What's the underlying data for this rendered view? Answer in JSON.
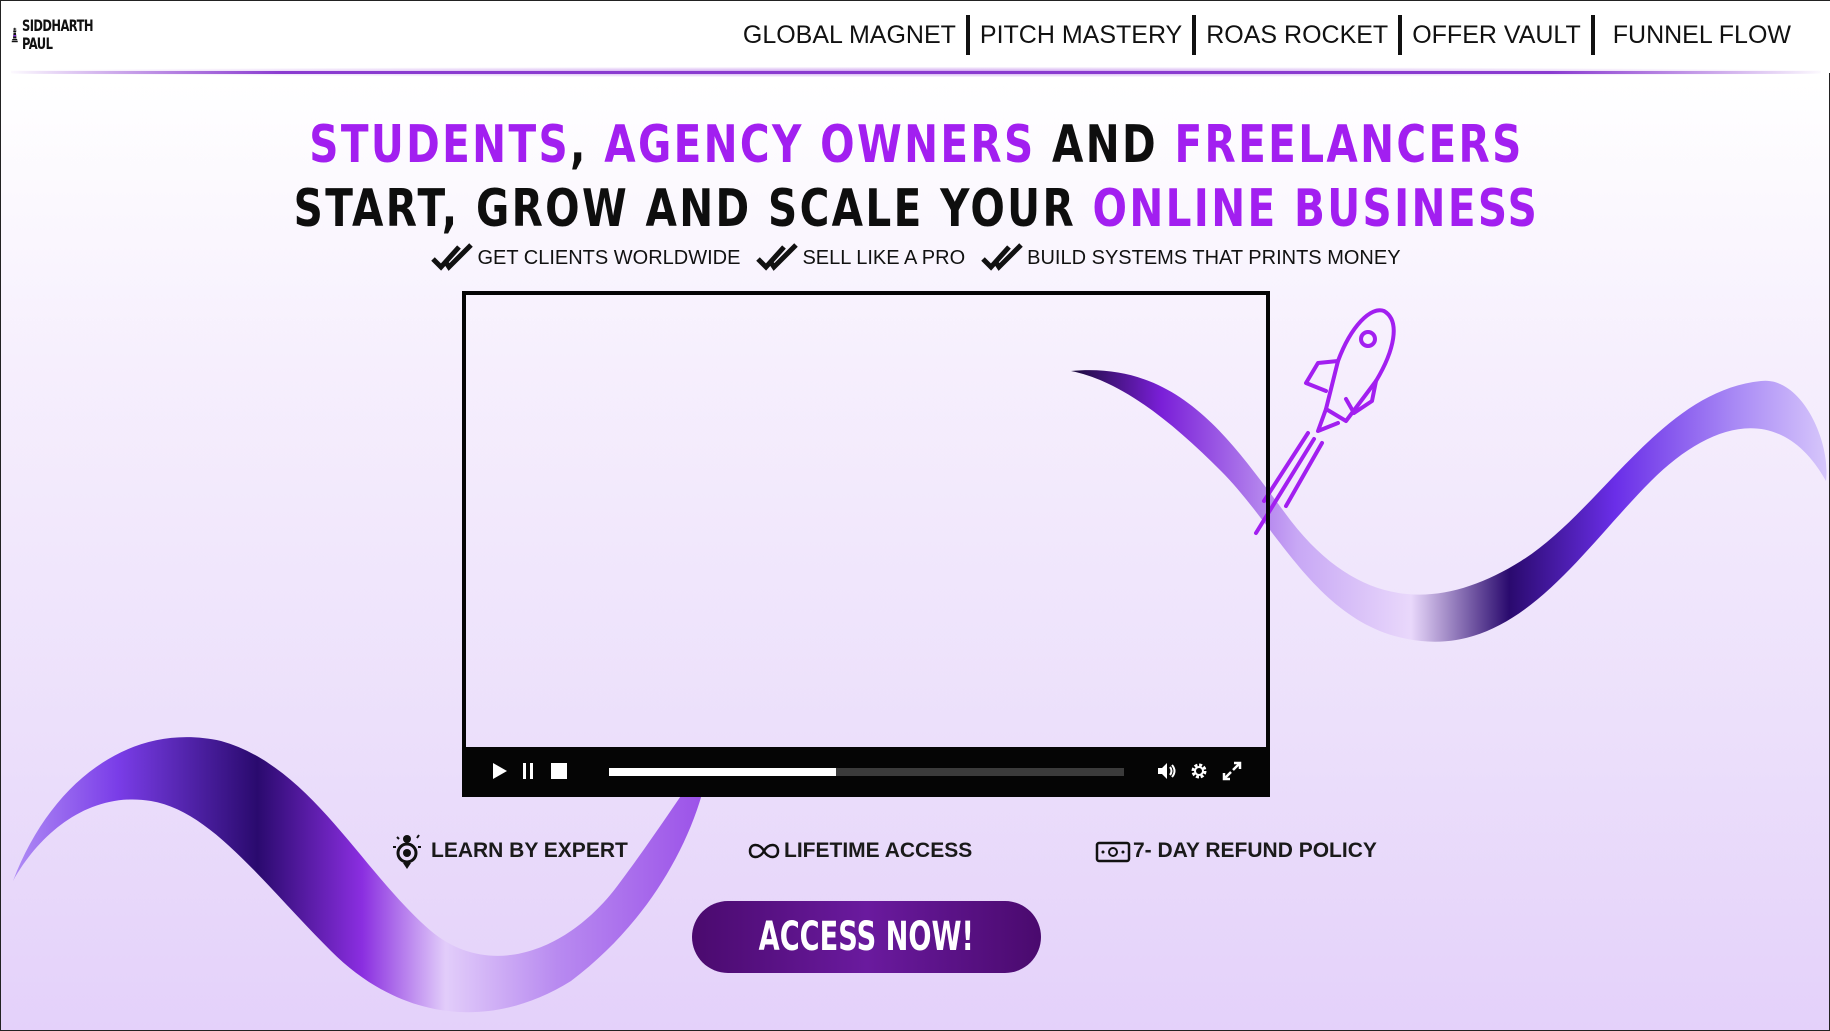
{
  "brand": {
    "logo_line1": "SIDDHARTH",
    "logo_line2": "PAUL",
    "logo_icon": "chess-king-icon"
  },
  "nav": {
    "items": [
      "GLOBAL MAGNET",
      "PITCH MASTERY",
      "ROAS ROCKET",
      "OFFER VAULT",
      "FUNNEL FLOW"
    ]
  },
  "headline": {
    "line1": {
      "part1": "STUDENTS",
      "sep1": ", ",
      "part2": "AGENCY OWNERS",
      "sep2": " AND ",
      "part3": "FREELANCERS"
    },
    "line2": {
      "part1": "START, GROW AND SCALE YOUR ",
      "part2": "ONLINE BUSINESS"
    }
  },
  "features": [
    {
      "label": "GET CLIENTS WORLDWIDE",
      "icon": "double-check-icon"
    },
    {
      "label": "SELL LIKE A PRO",
      "icon": "double-check-icon"
    },
    {
      "label": "BUILD SYSTEMS THAT PRINTS MONEY",
      "icon": "double-check-icon"
    }
  ],
  "video": {
    "progress_fraction": 0.44,
    "controls": [
      "play-icon",
      "pause-icon",
      "stop-icon",
      "volume-icon",
      "settings-icon",
      "fullscreen-icon"
    ]
  },
  "benefits": [
    {
      "label": "LEARN BY EXPERT",
      "icon": "expert-badge-icon"
    },
    {
      "label": "LIFETIME ACCESS",
      "icon": "infinity-icon"
    },
    {
      "label": "7- DAY REFUND POLICY",
      "icon": "money-icon"
    }
  ],
  "cta": {
    "label": "ACCESS NOW!"
  },
  "colors": {
    "accent": "#a21ff0",
    "cta": "#5a1282",
    "text": "#111111",
    "ribbon": "#7b2ff0"
  },
  "decor": {
    "rocket_icon": "rocket-icon"
  }
}
